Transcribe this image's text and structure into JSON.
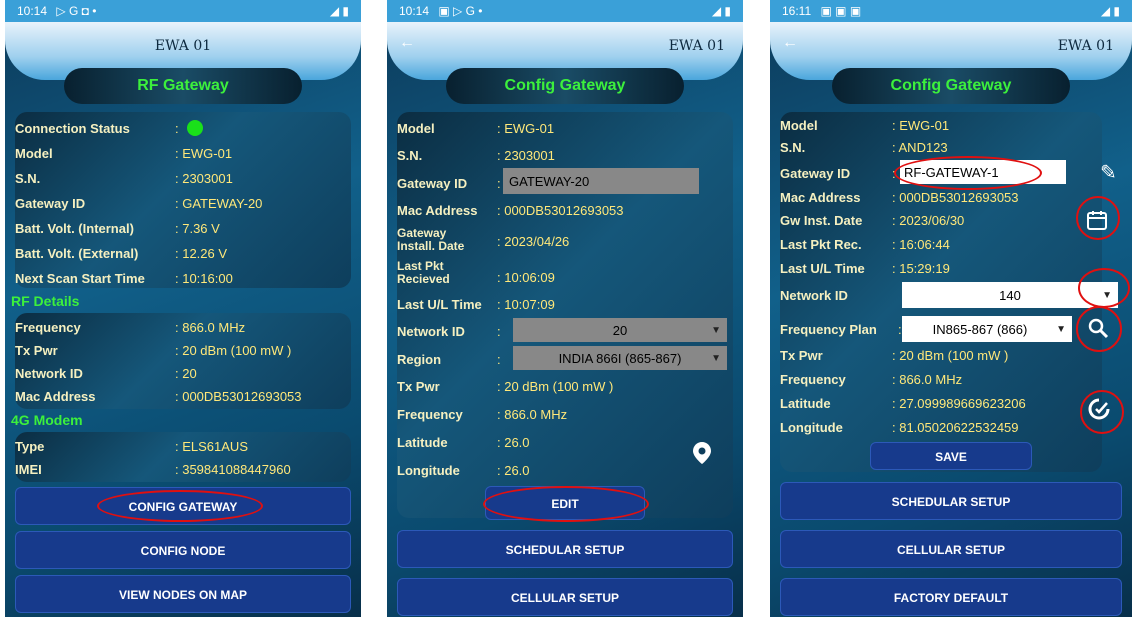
{
  "phone1": {
    "status_time": "10:14",
    "status_icons": "▷ G ◘ •",
    "header_title": "EWA 01",
    "pill_title": "RF Gateway",
    "rows": [
      {
        "label": "Connection Status",
        "value": ":"
      },
      {
        "label": "Model",
        "value": ": EWG-01"
      },
      {
        "label": "S.N.",
        "value": ": 2303001"
      },
      {
        "label": "Gateway ID",
        "value": ": GATEWAY-20"
      },
      {
        "label": "Batt. Volt. (Internal)",
        "value": ": 7.36 V"
      },
      {
        "label": "Batt. Volt. (External)",
        "value": ": 12.26 V"
      },
      {
        "label": "Next Scan Start Time",
        "value": ": 10:16:00"
      }
    ],
    "rf_section": "RF Details",
    "rf_rows": [
      {
        "label": "Frequency",
        "value": ": 866.0 MHz"
      },
      {
        "label": "Tx Pwr",
        "value": ": 20 dBm (100 mW )"
      },
      {
        "label": "Network ID",
        "value": ": 20"
      },
      {
        "label": "Mac Address",
        "value": ": 000DB53012693053"
      }
    ],
    "modem_section": "4G Modem",
    "modem_rows": [
      {
        "label": "Type",
        "value": ": ELS61AUS"
      },
      {
        "label": "IMEI",
        "value": ": 359841088447960"
      }
    ],
    "buttons": [
      "CONFIG GATEWAY",
      "CONFIG NODE",
      "VIEW NODES ON MAP"
    ]
  },
  "phone2": {
    "status_time": "10:14",
    "status_icons": "▣ ▷ G •",
    "header_title": "EWA 01",
    "pill_title": "Config Gateway",
    "model_label": "Model",
    "model_value": ": EWG-01",
    "sn_label": "S.N.",
    "sn_value": ": 2303001",
    "gwid_label": "Gateway ID",
    "gwid_value": "GATEWAY-20",
    "mac_label": "Mac Address",
    "mac_value": ": 000DB53012693053",
    "inst_label": "Gateway Install. Date",
    "inst_value": ": 2023/04/26",
    "pkt_label": "Last Pkt Recieved",
    "pkt_value": ": 10:06:09",
    "ul_label": "Last U/L Time",
    "ul_value": ": 10:07:09",
    "netid_label": "Network ID",
    "netid_value": "20",
    "region_label": "Region",
    "region_value": "INDIA 866I (865-867)",
    "tx_label": "Tx Pwr",
    "tx_value": ": 20 dBm (100 mW )",
    "freq_label": "Frequency",
    "freq_value": ": 866.0 MHz",
    "lat_label": "Latitude",
    "lat_value": ": 26.0",
    "lon_label": "Longitude",
    "lon_value": ": 26.0",
    "edit_button": "EDIT",
    "buttons": [
      "SCHEDULAR SETUP",
      "CELLULAR SETUP"
    ]
  },
  "phone3": {
    "status_time": "16:11",
    "status_icons": "▣ ▣ ▣",
    "header_title": "EWA 01",
    "pill_title": "Config Gateway",
    "model_label": "Model",
    "model_value": ": EWG-01",
    "sn_label": "S.N.",
    "sn_value": ": AND123",
    "gwid_label": "Gateway ID",
    "gwid_value": "RF-GATEWAY-1",
    "mac_label": "Mac Address",
    "mac_value": ": 000DB53012693053",
    "inst_label": "Gw Inst. Date",
    "inst_value": ": 2023/06/30",
    "pkt_label": "Last Pkt Rec.",
    "pkt_value": ": 16:06:44",
    "ul_label": "Last U/L Time",
    "ul_value": ": 15:29:19",
    "netid_label": "Network ID",
    "netid_value": "140",
    "fplan_label": "Frequency Plan",
    "fplan_value": "IN865-867 (866)",
    "tx_label": "Tx Pwr",
    "tx_value": ": 20 dBm (100 mW )",
    "freq_label": "Frequency",
    "freq_value": ": 866.0 MHz",
    "lat_label": "Latitude",
    "lat_value": ": 27.099989669623206",
    "lon_label": "Longitude",
    "lon_value": ": 81.05020622532459",
    "save_button": "SAVE",
    "buttons": [
      "SCHEDULAR SETUP",
      "CELLULAR SETUP",
      "FACTORY DEFAULT"
    ]
  }
}
